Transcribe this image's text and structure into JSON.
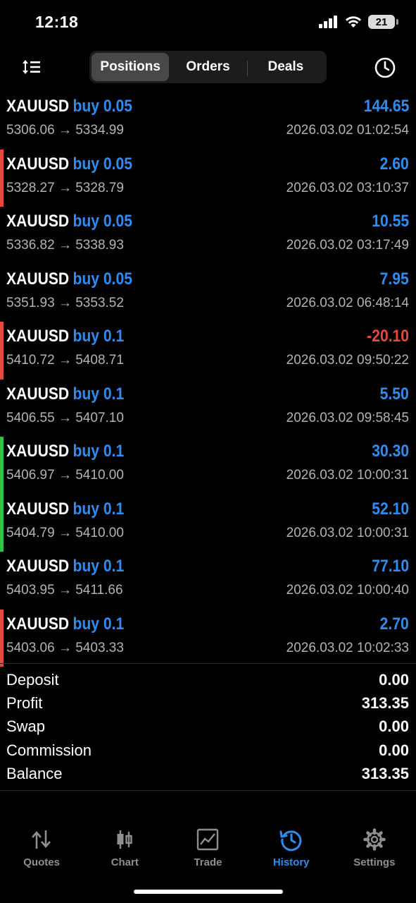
{
  "status_bar": {
    "time": "12:18",
    "battery": "21"
  },
  "toolbar": {
    "tabs": [
      {
        "label": "Positions",
        "active": true
      },
      {
        "label": "Orders",
        "active": false
      },
      {
        "label": "Deals",
        "active": false
      }
    ],
    "left_icon": "sort-icon",
    "right_icon": "clock-icon"
  },
  "colors": {
    "positive": "#2f8cf0",
    "negative": "#e5483f",
    "bar_red": "#e5483f",
    "bar_green": "#30c24a",
    "accent": "#2f8cf0"
  },
  "deals": [
    {
      "symbol": "XAUUSD",
      "side": "buy 0.05",
      "prices": "5306.06 → 5334.99",
      "profit": "144.65",
      "time": "2026.03.02 01:02:54",
      "marker": "none"
    },
    {
      "symbol": "XAUUSD",
      "side": "buy 0.05",
      "prices": "5328.27 → 5328.79",
      "profit": "2.60",
      "time": "2026.03.02 03:10:37",
      "marker": "red"
    },
    {
      "symbol": "XAUUSD",
      "side": "buy 0.05",
      "prices": "5336.82 → 5338.93",
      "profit": "10.55",
      "time": "2026.03.02 03:17:49",
      "marker": "none"
    },
    {
      "symbol": "XAUUSD",
      "side": "buy 0.05",
      "prices": "5351.93 → 5353.52",
      "profit": "7.95",
      "time": "2026.03.02 06:48:14",
      "marker": "none"
    },
    {
      "symbol": "XAUUSD",
      "side": "buy 0.1",
      "prices": "5410.72 → 5408.71",
      "profit": "-20.10",
      "time": "2026.03.02 09:50:22",
      "marker": "red"
    },
    {
      "symbol": "XAUUSD",
      "side": "buy 0.1",
      "prices": "5406.55 → 5407.10",
      "profit": "5.50",
      "time": "2026.03.02 09:58:45",
      "marker": "none"
    },
    {
      "symbol": "XAUUSD",
      "side": "buy 0.1",
      "prices": "5406.97 → 5410.00",
      "profit": "30.30",
      "time": "2026.03.02 10:00:31",
      "marker": "green"
    },
    {
      "symbol": "XAUUSD",
      "side": "buy 0.1",
      "prices": "5404.79 → 5410.00",
      "profit": "52.10",
      "time": "2026.03.02 10:00:31",
      "marker": "green"
    },
    {
      "symbol": "XAUUSD",
      "side": "buy 0.1",
      "prices": "5403.95 → 5411.66",
      "profit": "77.10",
      "time": "2026.03.02 10:00:40",
      "marker": "none"
    },
    {
      "symbol": "XAUUSD",
      "side": "buy 0.1",
      "prices": "5403.06 → 5403.33",
      "profit": "2.70",
      "time": "2026.03.02 10:02:33",
      "marker": "red"
    }
  ],
  "summary": [
    {
      "label": "Deposit",
      "value": "0.00"
    },
    {
      "label": "Profit",
      "value": "313.35"
    },
    {
      "label": "Swap",
      "value": "0.00"
    },
    {
      "label": "Commission",
      "value": "0.00"
    },
    {
      "label": "Balance",
      "value": "313.35"
    }
  ],
  "tabbar": [
    {
      "label": "Quotes",
      "icon": "quotes-icon",
      "active": false
    },
    {
      "label": "Chart",
      "icon": "candlestick-icon",
      "active": false
    },
    {
      "label": "Trade",
      "icon": "trade-chart-icon",
      "active": false
    },
    {
      "label": "History",
      "icon": "history-icon",
      "active": true
    },
    {
      "label": "Settings",
      "icon": "gear-icon",
      "active": false
    }
  ]
}
